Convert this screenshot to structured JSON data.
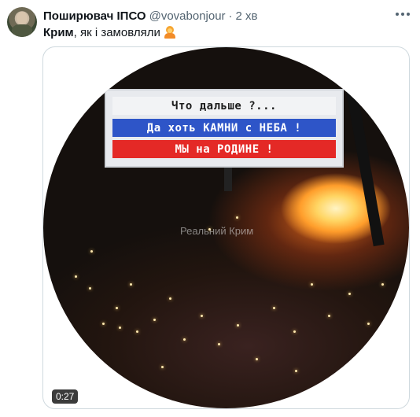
{
  "tweet": {
    "author_name": "Поширювач ІПСО",
    "author_handle": "@vovabonjour",
    "separator": "·",
    "time": "2 хв",
    "text_bold": "Крим",
    "text_rest": ", як і замовляли",
    "emoji": "person-raising-hand-emoji",
    "more_icon": "ellipsis-icon"
  },
  "media": {
    "type": "video",
    "billboard_line1": "Что дальше ?...",
    "billboard_line2": "Да хоть КАМНИ с НЕБА !",
    "billboard_line3": "МЫ на РОДИНЕ !",
    "watermark": "Реальний Крим",
    "duration": "0:27",
    "colors": {
      "billboard_blue": "#2e55c8",
      "billboard_red": "#e42926",
      "fire": "#ffd563"
    }
  }
}
